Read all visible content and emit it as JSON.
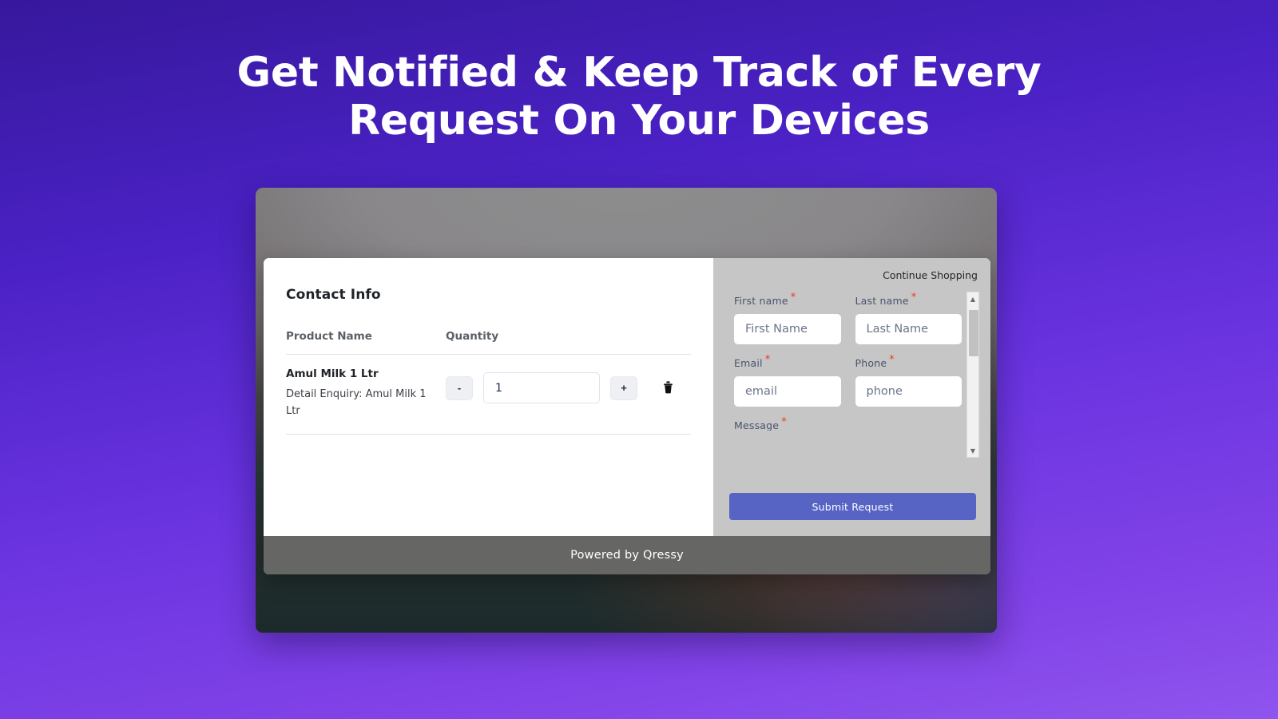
{
  "hero": {
    "heading_line1": "Get Notified & Keep Track of Every",
    "heading_line2": "Request On Your Devices"
  },
  "colors": {
    "bg_gradient_top": "#36189c",
    "bg_gradient_bottom": "#8f55ee",
    "submit_button": "#5764c4",
    "required_asterisk": "#f0391b",
    "footer_bar": "#666665",
    "form_panel": "#c6c6c6"
  },
  "modal": {
    "cart": {
      "title": "Contact Info",
      "columns": [
        "Product Name",
        "Quantity"
      ],
      "rows": [
        {
          "name": "Amul Milk 1 Ltr",
          "detail": "Detail Enquiry: Amul Milk 1 Ltr",
          "quantity": "1",
          "decrement_label": "-",
          "increment_label": "+",
          "delete_icon": "trash-icon"
        }
      ]
    },
    "form": {
      "continue_shopping": "Continue Shopping",
      "fields": [
        {
          "label": "First name",
          "required": "*",
          "placeholder": "First Name",
          "value": ""
        },
        {
          "label": "Last name",
          "required": "*",
          "placeholder": "Last Name",
          "value": ""
        },
        {
          "label": "Email",
          "required": "*",
          "placeholder": "email",
          "value": ""
        },
        {
          "label": "Phone",
          "required": "*",
          "placeholder": "phone",
          "value": ""
        }
      ],
      "clipped_field": {
        "label": "Message",
        "required": "*"
      },
      "scrollbar": {
        "up_arrow": "▲",
        "down_arrow": "▼"
      },
      "submit_label": "Submit Request"
    },
    "footer_text": "Powered by Qressy"
  }
}
